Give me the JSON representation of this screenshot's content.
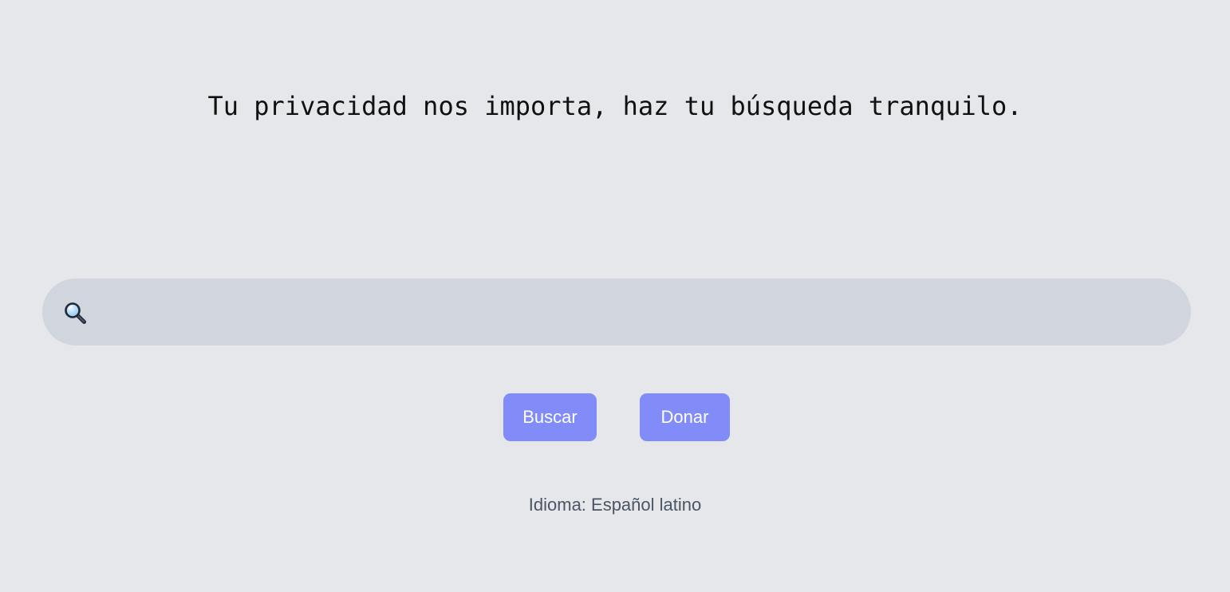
{
  "tagline": "Tu privacidad nos importa, haz tu búsqueda tranquilo.",
  "search": {
    "icon": "magnifying-glass-icon",
    "value": "",
    "placeholder": ""
  },
  "buttons": {
    "search_label": "Buscar",
    "donate_label": "Donar"
  },
  "language": {
    "text": "Idioma: Español latino"
  },
  "colors": {
    "background": "#e5e7eb",
    "search_bar": "#d1d5de",
    "button": "#818cf8",
    "button_text": "#ffffff",
    "language_text": "#4b5563"
  }
}
